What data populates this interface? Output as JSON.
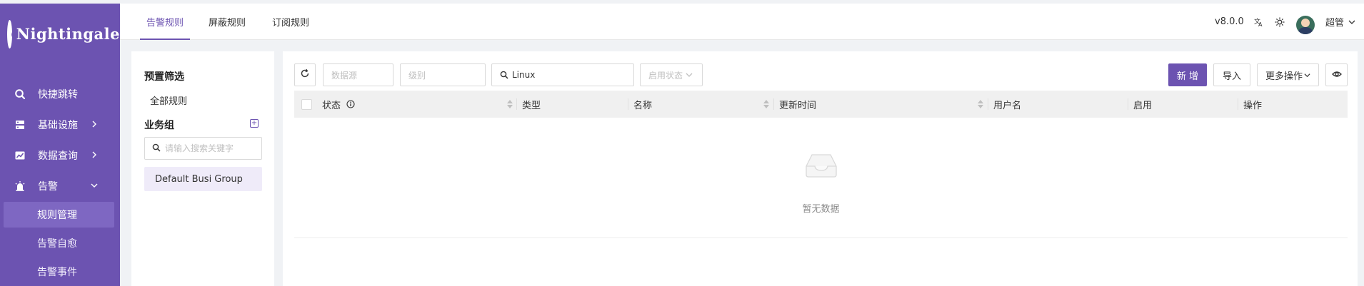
{
  "sidebar": {
    "logo": "Nightingale",
    "items": [
      {
        "label": "快捷跳转"
      },
      {
        "label": "基础设施"
      },
      {
        "label": "数据查询"
      },
      {
        "label": "告警"
      }
    ],
    "alert_sub": [
      {
        "label": "规则管理"
      },
      {
        "label": "告警自愈"
      },
      {
        "label": "告警事件"
      }
    ]
  },
  "header": {
    "tabs": [
      {
        "label": "告警规则"
      },
      {
        "label": "屏蔽规则"
      },
      {
        "label": "订阅规则"
      }
    ],
    "version": "v8.0.0",
    "username": "超管"
  },
  "filter_panel": {
    "preset_title": "预置筛选",
    "all_rules": "全部规则",
    "group_title": "业务组",
    "search_placeholder": "请输入搜索关键字",
    "group_item": "Default Busi Group"
  },
  "toolbar": {
    "datasource_placeholder": "数据源",
    "severity_placeholder": "级别",
    "search_value": "Linux",
    "status_placeholder": "启用状态",
    "new_label": "新 增",
    "import_label": "导入",
    "more_label": "更多操作"
  },
  "table": {
    "columns": [
      "状态",
      "类型",
      "名称",
      "更新时间",
      "用户名",
      "启用",
      "操作"
    ],
    "rows": [],
    "empty_text": "暂无数据"
  },
  "colors": {
    "brand": "#6c53b1",
    "sidebar_active": "#7e67c2"
  }
}
